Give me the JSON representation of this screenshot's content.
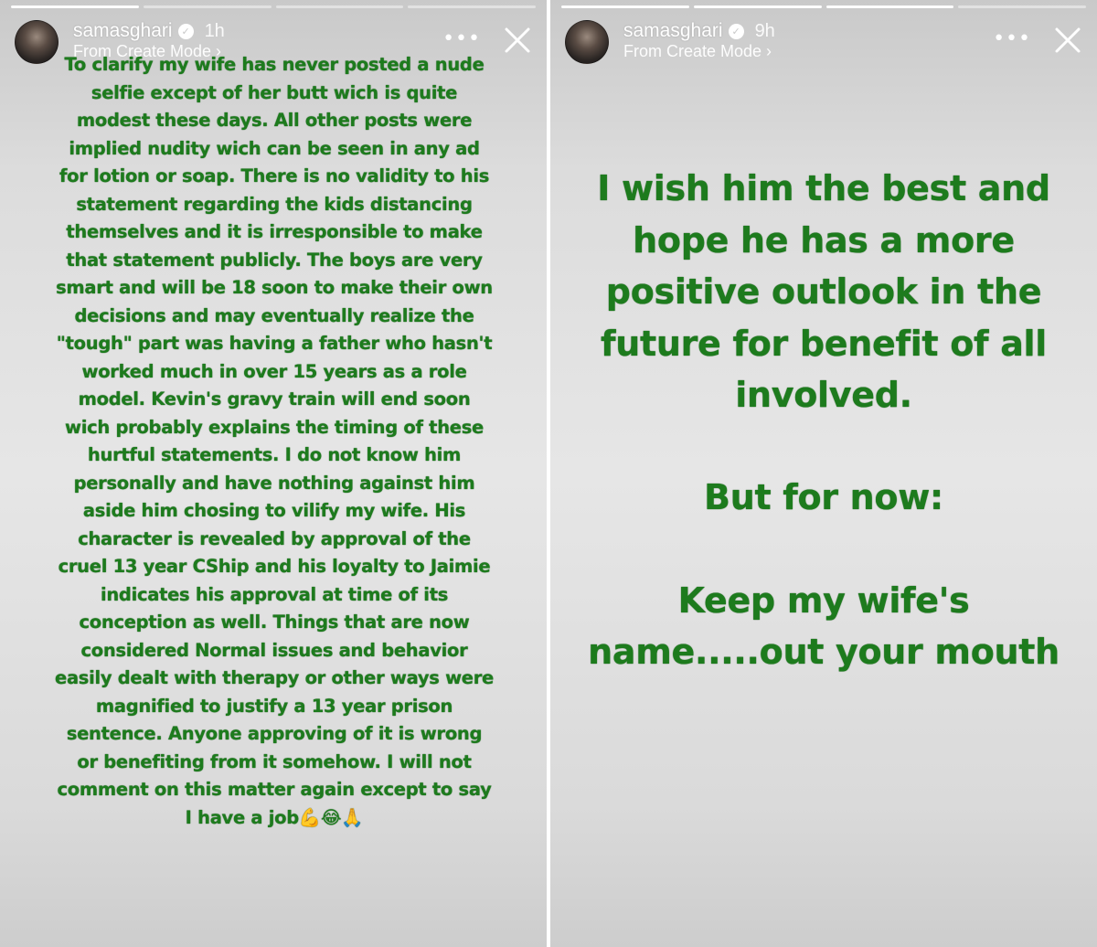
{
  "stories": [
    {
      "username": "samasghari",
      "verified_icon": "check-badge-icon",
      "time": "1h",
      "subtitle": "From Create Mode ›",
      "more_label": "•••",
      "progress_segments": 4,
      "progress_done": 1,
      "text": "To clarify my wife has never posted a nude selfie except of her butt wich is quite modest these days. All other posts were implied nudity wich can be seen in any ad for lotion or soap. There is no validity to his statement regarding the kids distancing themselves and it is irresponsible to make that statement publicly. The boys are very smart and will be 18 soon to make their own decisions and may eventually realize the \"tough\" part was having a father who hasn't worked much in over 15 years as a role model. Kevin's gravy train will end soon wich probably explains the timing of these hurtful statements. I do not know him personally and have nothing against him aside him chosing to vilify my wife. His character is revealed by approval of the cruel 13 year CShip and his loyalty to Jaimie indicates his approval at time of its conception as well. Things that are now considered Normal issues and behavior easily dealt with therapy or other ways were magnified to justify a 13 year prison sentence. Anyone approving of it is wrong or benefiting from it somehow. I will not comment on this matter again except to say I have a job💪😂🙏"
    },
    {
      "username": "samasghari",
      "verified_icon": "check-badge-icon",
      "time": "9h",
      "subtitle": "From Create Mode ›",
      "more_label": "•••",
      "progress_segments": 4,
      "progress_done": 3,
      "text_1": "I wish him the best and hope he has a more positive outlook in the future for benefit of all involved.",
      "text_2": "But for now:",
      "text_3": "Keep my wife's name.....out your mouth"
    }
  ],
  "colors": {
    "story_text": "#1d7b1d",
    "background": "#e6e6e6"
  }
}
